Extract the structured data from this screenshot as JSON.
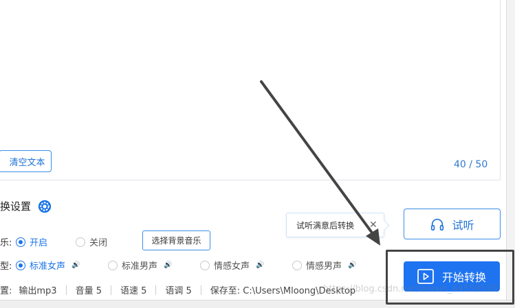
{
  "editor": {
    "clear_label": "清空文本",
    "counter": "40 / 50"
  },
  "settings": {
    "title_fragment": "换设置",
    "music_label_fragment": "乐:",
    "music_on": "开启",
    "music_off": "关闭",
    "bgm_button": "选择背景音乐",
    "voice_label_fragment": "型:",
    "voices": [
      "标准女声",
      "标准男声",
      "情感女声",
      "情感男声"
    ],
    "selected_voice": "标准女声"
  },
  "status": {
    "label_fragment": "置:",
    "output": "输出mp3",
    "volume": "音量 5",
    "speed": "语速 5",
    "pitch": "语调 5",
    "save_to": "保存至: C:\\Users\\Mloong\\Desktop"
  },
  "tooltip": {
    "text": "试听满意后转换",
    "close": "✕"
  },
  "actions": {
    "listen_label": "试听",
    "start_label": "开始转换"
  },
  "watermark": "https://blog.csdn.net/weixin_44559520",
  "colors": {
    "accent": "#1e73f0",
    "annotation": "#444444"
  }
}
